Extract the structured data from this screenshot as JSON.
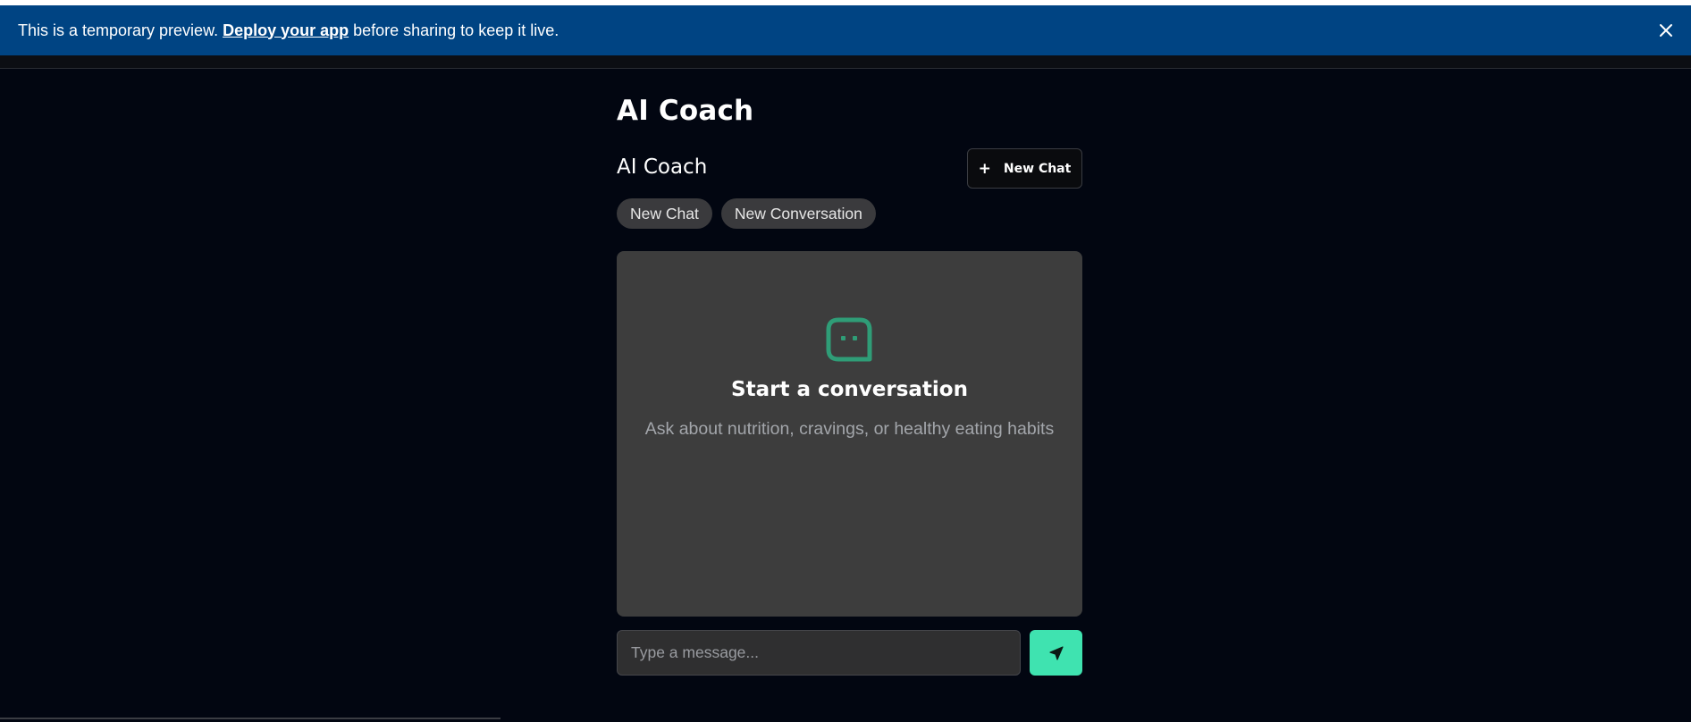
{
  "banner": {
    "text_before": "This is a temporary preview.",
    "link_label": "Deploy your app",
    "text_after": "before sharing to keep it live.",
    "close_icon": "close-icon",
    "background": "#004483"
  },
  "page": {
    "title": "AI Coach"
  },
  "coach": {
    "title": "AI Coach",
    "new_chat_button_label": "New Chat",
    "new_chat_button_icon": "plus-icon"
  },
  "chips": [
    {
      "label": "New Chat"
    },
    {
      "label": "New Conversation"
    }
  ],
  "empty_state": {
    "icon": "chat-bubble-icon",
    "title": "Start a conversation",
    "subtitle": "Ask about nutrition, cravings, or healthy eating habits",
    "icon_color": "#2f9d77"
  },
  "composer": {
    "placeholder": "Type a message...",
    "send_icon": "send-icon",
    "send_color": "#3fe3b0"
  }
}
